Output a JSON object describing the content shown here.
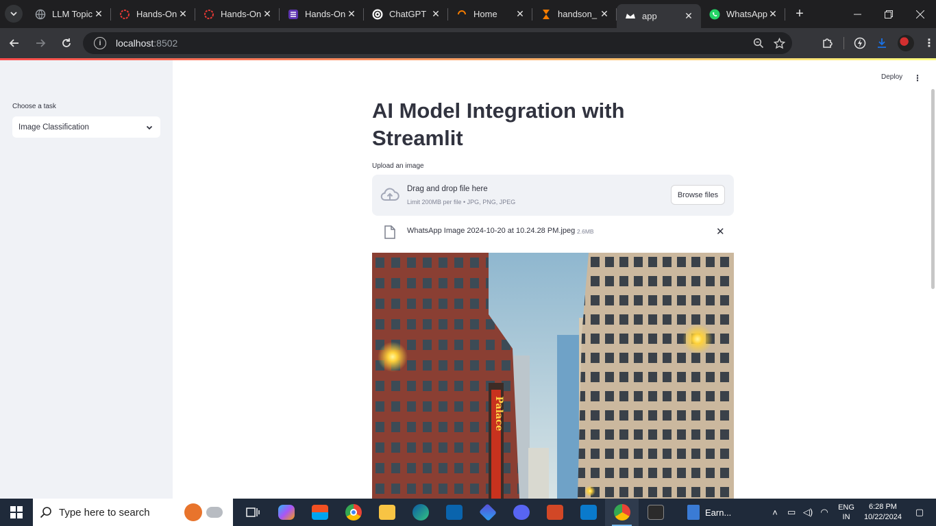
{
  "browser": {
    "tabs": [
      {
        "title": "LLM Topic",
        "icon": "globe-icon",
        "active": false
      },
      {
        "title": "Hands-On",
        "icon": "circle-dotted-icon",
        "active": false
      },
      {
        "title": "Hands-On",
        "icon": "circle-dotted-icon",
        "active": false
      },
      {
        "title": "Hands-On",
        "icon": "list-app-icon",
        "active": false
      },
      {
        "title": "ChatGPT",
        "icon": "openai-icon",
        "active": false
      },
      {
        "title": "Home",
        "icon": "spinner-icon",
        "active": false
      },
      {
        "title": "handson_",
        "icon": "hourglass-icon",
        "active": false
      },
      {
        "title": "app",
        "icon": "streamlit-crown-icon",
        "active": true
      },
      {
        "title": "WhatsApp",
        "icon": "whatsapp-icon",
        "active": false
      }
    ],
    "address": {
      "host": "localhost",
      "port": ":8502"
    },
    "colors": {
      "frame": "#1f1f21",
      "toolbar": "#35363a",
      "omnibox": "#202124"
    }
  },
  "app": {
    "header": {
      "deploy_label": "Deploy"
    },
    "sidebar": {
      "task_label": "Choose a task",
      "task_selected": "Image Classification"
    },
    "main": {
      "title": "AI Model Integration with Streamlit",
      "upload_label": "Upload an image",
      "dropzone_title": "Drag and drop file here",
      "dropzone_limit": "Limit 200MB per file • JPG, PNG, JPEG",
      "browse_label": "Browse files",
      "file": {
        "name": "WhatsApp Image 2024-10-20 at 10.24.28 PM.jpeg",
        "size": "2.6MB"
      },
      "photo_sign": "Palace"
    },
    "colors": {
      "sidebar_bg": "#f0f2f6",
      "text": "#31333f",
      "accent": "#ff4b4b"
    }
  },
  "taskbar": {
    "search_placeholder": "Type here to search",
    "earn_label": "Earn...",
    "lang_top": "ENG",
    "lang_bottom": "IN",
    "time": "6:28 PM",
    "date": "10/22/2024"
  }
}
